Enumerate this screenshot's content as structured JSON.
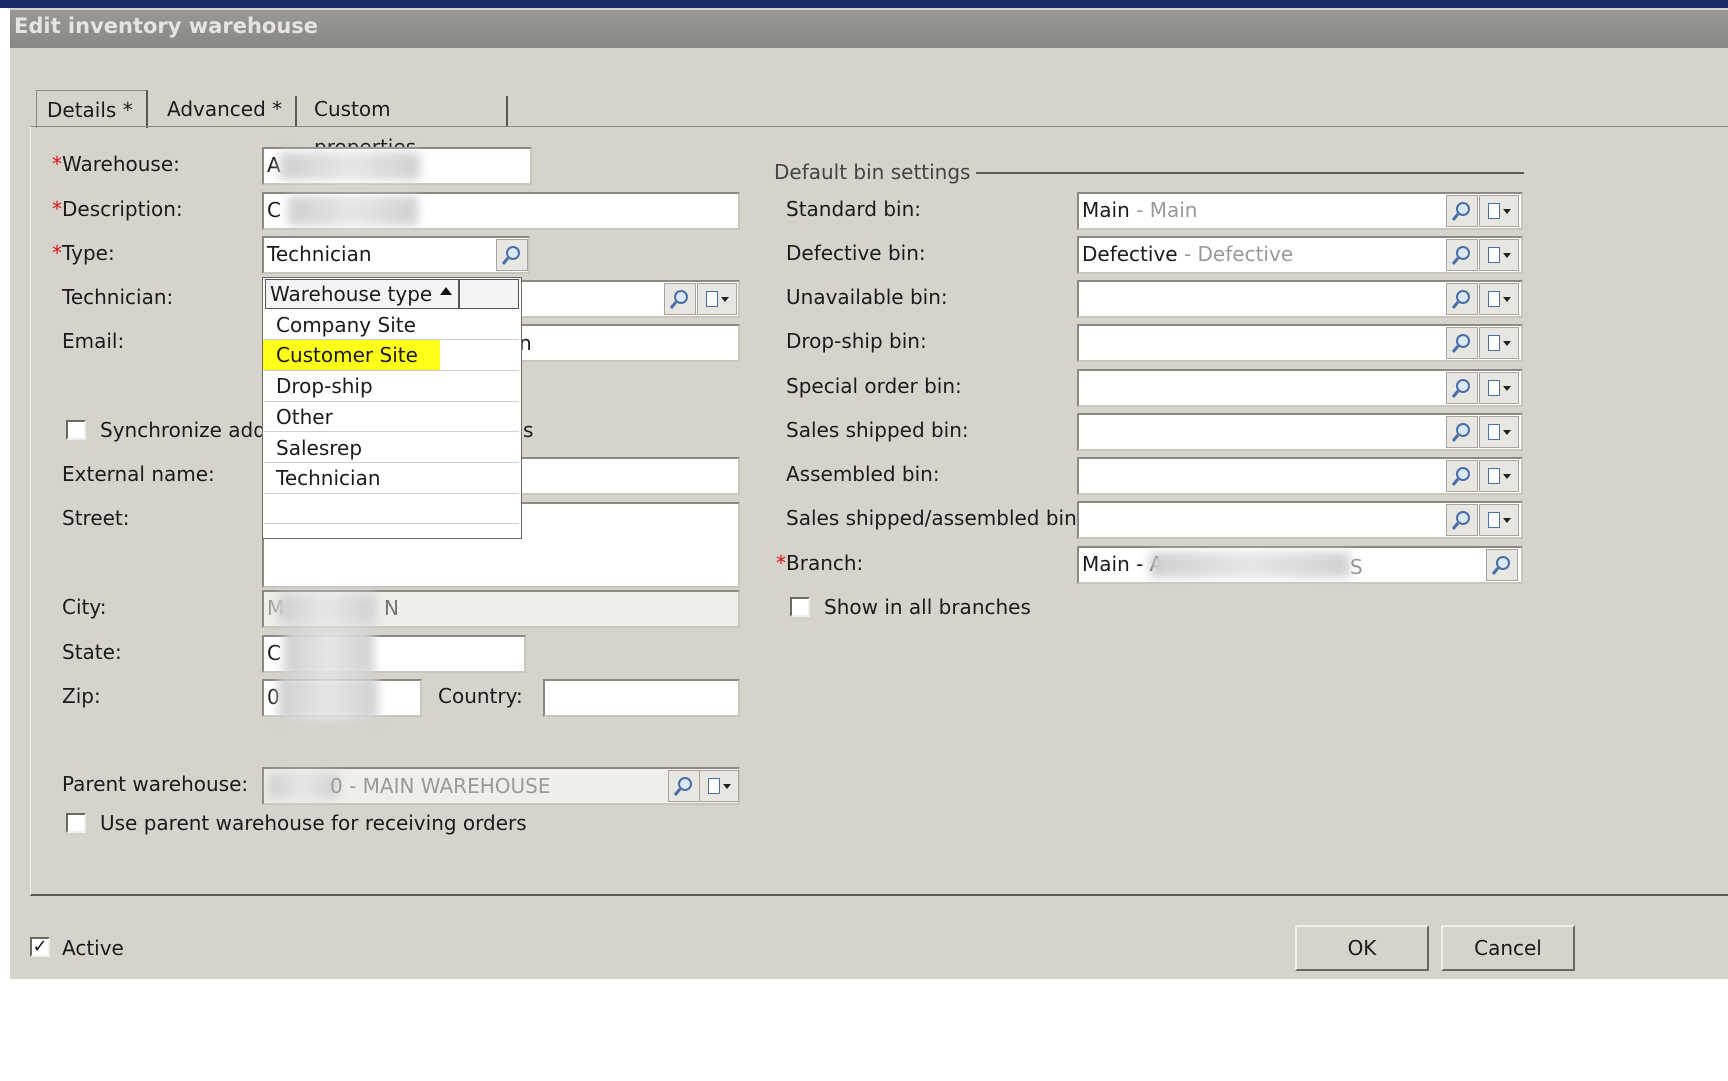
{
  "window": {
    "title": "Edit inventory warehouse"
  },
  "tabs": [
    {
      "label": "Details *"
    },
    {
      "label": "Advanced *"
    },
    {
      "label": "Custom properties"
    }
  ],
  "form": {
    "warehouse": {
      "label": "Warehouse:",
      "value": "A"
    },
    "description": {
      "label": "Description:",
      "value": "C"
    },
    "type": {
      "label": "Type:",
      "value": "Technician"
    },
    "technician": {
      "label": "Technician:"
    },
    "email": {
      "label": "Email:",
      "value_partial": "n"
    },
    "sync": {
      "label_left": "Synchronize add",
      "label_right": "s",
      "checked": false
    },
    "external_name": {
      "label": "External name:"
    },
    "street": {
      "label": "Street:"
    },
    "city": {
      "label": "City:",
      "value_left": "M",
      "value_right": "N"
    },
    "state": {
      "label": "State:",
      "value": "C"
    },
    "zip": {
      "label": "Zip:",
      "value": "0"
    },
    "country": {
      "label": "Country:",
      "value": ""
    },
    "parent_warehouse": {
      "label": "Parent warehouse:",
      "value_suffix": "0 - MAIN WAREHOUSE"
    },
    "use_parent": {
      "label": "Use parent warehouse for receiving orders",
      "checked": false
    }
  },
  "dropdown": {
    "header": "Warehouse type",
    "items": [
      "Company Site",
      "Customer Site",
      "Drop-ship",
      "Other",
      "Salesrep",
      "Technician"
    ],
    "highlighted": "Customer Site"
  },
  "bins": {
    "section_title": "Default bin settings",
    "standard": {
      "label": "Standard bin:",
      "code": "Main",
      "name": "Main"
    },
    "defective": {
      "label": "Defective bin:",
      "code": "Defective",
      "name": "Defective"
    },
    "unavailable": {
      "label": "Unavailable bin:"
    },
    "dropship": {
      "label": "Drop-ship bin:"
    },
    "special_order": {
      "label": "Special order bin:"
    },
    "sales_shipped": {
      "label": "Sales shipped bin:"
    },
    "assembled": {
      "label": "Assembled bin:"
    },
    "sales_shipped_assembled": {
      "label": "Sales shipped/assembled bin:"
    },
    "branch": {
      "label": "Branch:",
      "value_left": "Main - A",
      "value_right": "S"
    },
    "show_all": {
      "label": "Show in all branches",
      "checked": false
    }
  },
  "footer": {
    "active": {
      "label": "Active",
      "checked": true
    },
    "ok": "OK",
    "cancel": "Cancel"
  },
  "colors": {
    "highlight": "#ffff1a",
    "required": "#dd1111",
    "title_bar": "#8a8883",
    "dialog_bg": "#d6d3cc"
  }
}
